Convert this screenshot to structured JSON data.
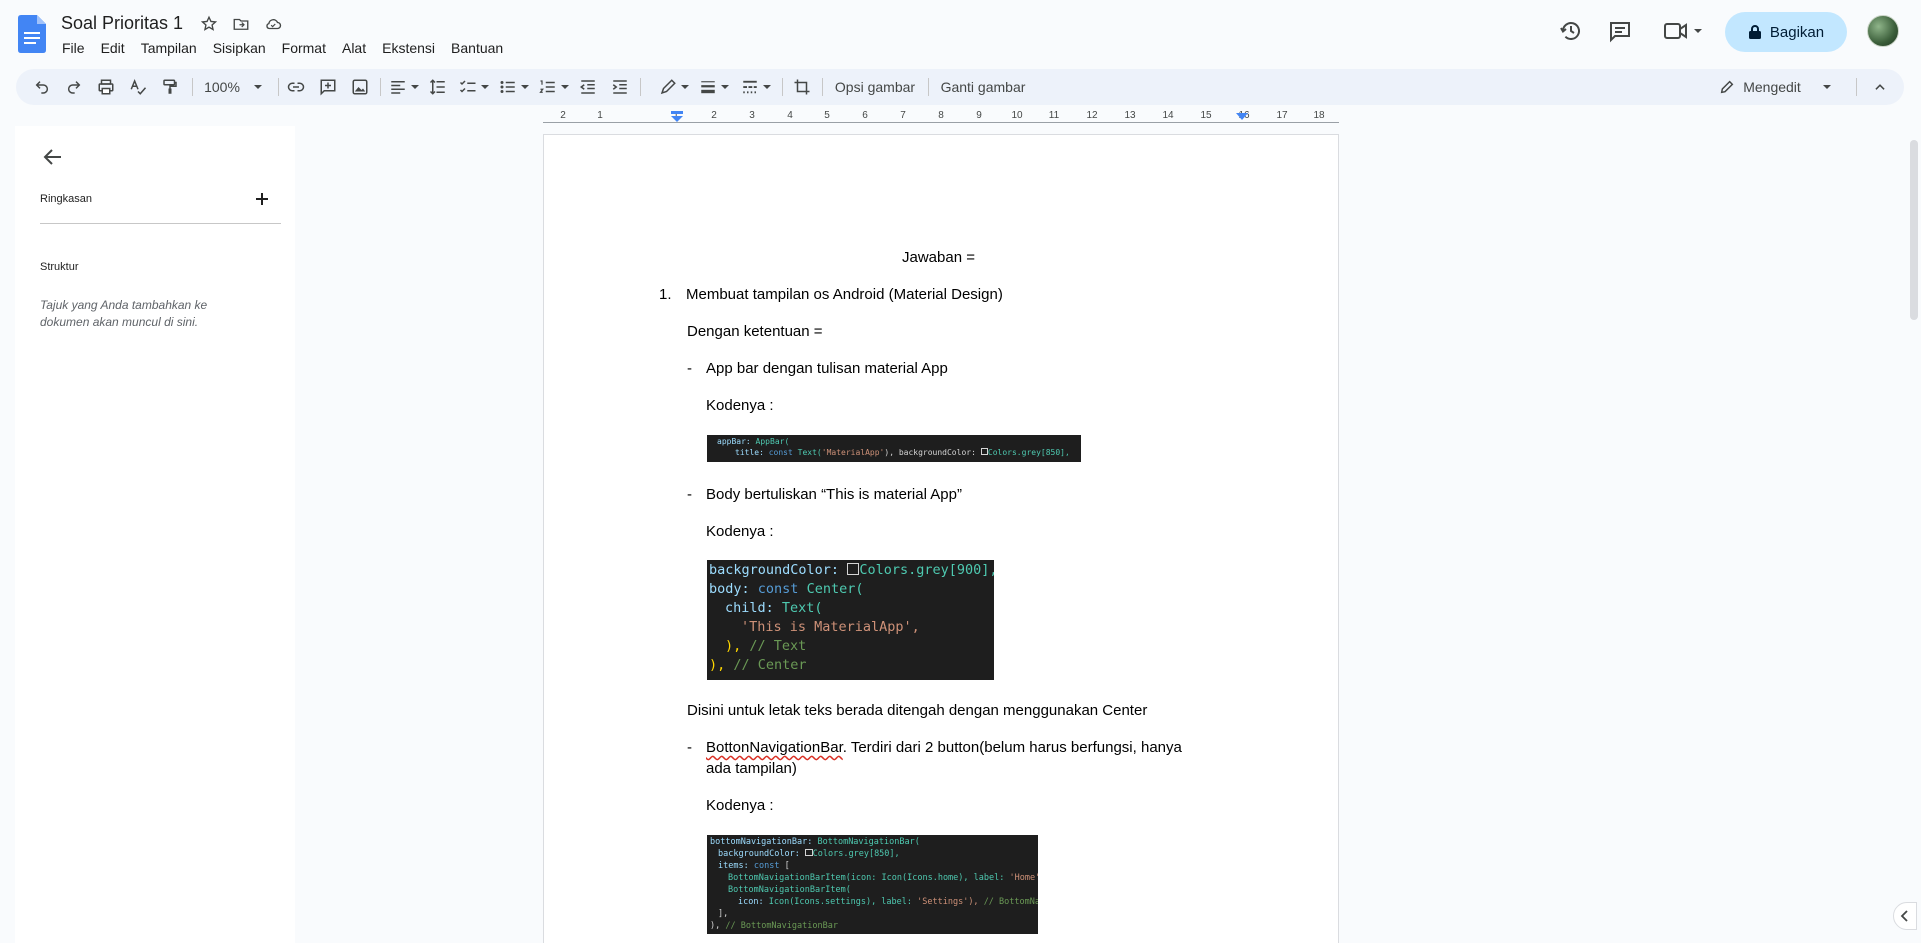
{
  "app": {
    "doc_title": "Soal Prioritas 1",
    "menu": [
      "File",
      "Edit",
      "Tampilan",
      "Sisipkan",
      "Format",
      "Alat",
      "Ekstensi",
      "Bantuan"
    ],
    "share_label": "Bagikan",
    "brand_color": "#4285f4",
    "share_color": "#c2e7ff"
  },
  "toolbar": {
    "zoom": "100%",
    "image_options_label": "Opsi gambar",
    "replace_image_label": "Ganti gambar",
    "mode_label": "Mengedit"
  },
  "ruler": {
    "labels": [
      "2",
      "1",
      "1",
      "2",
      "3",
      "4",
      "5",
      "6",
      "7",
      "8",
      "9",
      "10",
      "11",
      "12",
      "13",
      "14",
      "15",
      "16",
      "17",
      "18"
    ]
  },
  "sidebar": {
    "summary_label": "Ringkasan",
    "structure_label": "Struktur",
    "structure_hint": "Tajuk yang Anda tambahkan ke dokumen akan muncul di sini."
  },
  "document": {
    "heading": "Jawaban =",
    "item1_number": "1.",
    "item1_text": "Membuat tampilan os Android (Material Design)",
    "conditions": "Dengan ketentuan =",
    "dash": "-",
    "bullet1": "App bar dengan tulisan material App",
    "kodenya1": "Kodenya :",
    "bullet2": "Body bertuliskan “This is material App”",
    "kodenya2": "Kodenya :",
    "center_note": "Disini untuk letak teks berada ditengah dengan menggunakan Center",
    "bullet3_word": "BottonNavigationBar",
    "bullet3_rest": ". Terdiri dari 2 button(belum harus berfungsi, hanya",
    "bullet3_line2": "ada tampilan)",
    "kodenya3": "Kodenya :"
  },
  "code_images": {
    "appbar": {
      "line1_prop": "appBar:",
      "line1_cls": "AppBar(",
      "line2_prop": "title:",
      "line2_kw": "const",
      "line2_cls": "Text(",
      "line2_str": "'MaterialApp'",
      "line2_mid": "), backgroundColor:",
      "line2_colors": "Colors.grey[850],"
    },
    "body": {
      "l1_prop": "backgroundColor:",
      "l1_val": "Colors.grey[900],",
      "l2_prop": "body:",
      "l2_kw": "const",
      "l2_cls": "Center(",
      "l3_prop": "child:",
      "l3_cls": "Text(",
      "l4_str": "'This is MaterialApp',",
      "l5_pun": "),",
      "l5_com": "// Text",
      "l6_pun": "),",
      "l6_com": "// Center"
    },
    "bottomnav": {
      "l1_prop": "bottomNavigationBar:",
      "l1_cls": "BottomNavigationBar(",
      "l2_prop": "backgroundColor:",
      "l2_val": "Colors.grey[850],",
      "l3_prop": "items:",
      "l3_kw": "const",
      "l3_pun": "[",
      "l4_cls": "BottomNavigationBarItem(icon:",
      "l4_rest": "Icon(Icons.home), label:",
      "l4_str": "'Home'),",
      "l5_cls": "BottomNavigationBarItem(",
      "l6_prop": "icon:",
      "l6_rest": "Icon(Icons.settings), label:",
      "l6_str": "'Settings'),",
      "l6_com": "// BottomNav",
      "l7_pun": "],",
      "l8_pun": "),",
      "l8_com": "// BottomNavigationBar"
    }
  }
}
